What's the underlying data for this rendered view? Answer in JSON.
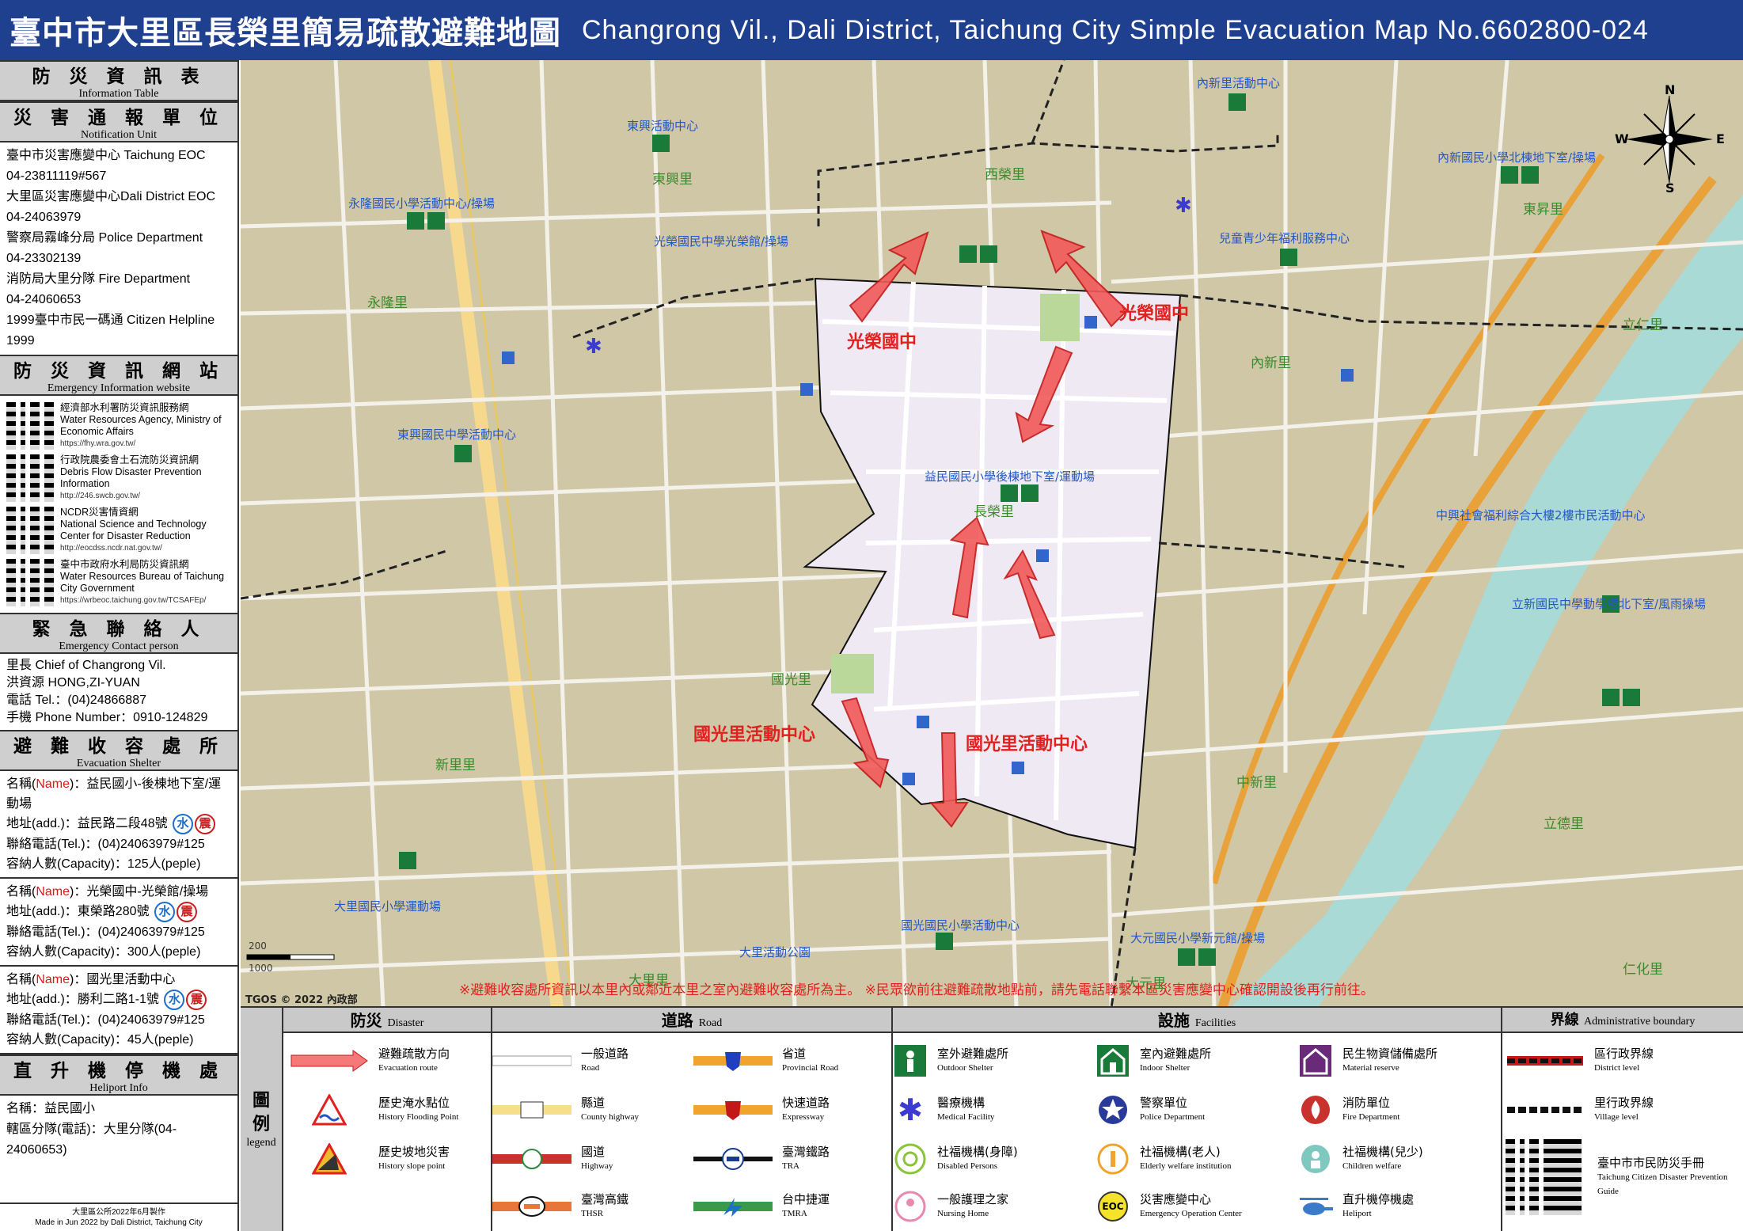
{
  "header": {
    "title_zh": "臺中市大里區長榮里簡易疏散避難地圖",
    "title_en": "Changrong Vil., Dali District, Taichung City Simple Evacuation Map No.6602800-024"
  },
  "side": {
    "info_table": {
      "zh": "防 災 資 訊 表",
      "en": "Information Table"
    },
    "notification": {
      "zh": "災 害 通 報 單 位",
      "en": "Notification Unit",
      "lines": [
        "臺中市災害應變中心 Taichung EOC",
        "04-23811119#567",
        "大里區災害應變中心Dali District EOC",
        "04-24063979",
        "警察局霧峰分局 Police Department",
        "04-23302139",
        "消防局大里分隊 Fire Department",
        "04-24060653",
        "1999臺中市民一碼通 Citizen Helpline",
        "1999"
      ]
    },
    "website": {
      "zh": "防 災 資 訊 網 站",
      "en": "Emergency Information website",
      "items": [
        {
          "zh": "經濟部水利署防災資訊服務網",
          "en": "Water Resources Agency, Ministry of Economic Affairs",
          "url": "https://fhy.wra.gov.tw/"
        },
        {
          "zh": "行政院農委會土石流防災資訊網",
          "en": "Debris Flow Disaster Prevention Information",
          "url": "http://246.swcb.gov.tw/"
        },
        {
          "zh": "NCDR災害情資網",
          "en": "National Science and Technology Center for Disaster Reduction",
          "url": "http://eocdss.ncdr.nat.gov.tw/"
        },
        {
          "zh": "臺中市政府水利局防災資訊網",
          "en": "Water Resources Bureau of Taichung City Government",
          "url": "https://wrbeoc.taichung.gov.tw/TCSAFEp/"
        }
      ]
    },
    "contact": {
      "zh": "緊 急 聯 絡 人",
      "en": "Emergency Contact person",
      "lines": [
        "里長 Chief of Changrong Vil.",
        "洪資源 HONG,ZI-YUAN",
        "電話 Tel.：(04)24866887",
        "手機 Phone Number：0910-124829"
      ]
    },
    "shelter": {
      "zh": "避 難 收 容 處 所",
      "en": "Evacuation Shelter",
      "items": [
        {
          "name_label": "名稱(",
          "name_mid": "Name",
          "name_end": ")：益民國小-後棟地下室/運動場",
          "addr": "地址(add.)：益民路二段48號",
          "tel": "聯絡電話(Tel.)：(04)24063979#125",
          "cap": "容納人數(Capacity)：125人(peple)"
        },
        {
          "name_label": "名稱(",
          "name_mid": "Name",
          "name_end": ")：光榮國中-光榮館/操場",
          "addr": "地址(add.)：東榮路280號",
          "tel": "聯絡電話(Tel.)：(04)24063979#125",
          "cap": "容納人數(Capacity)：300人(peple)"
        },
        {
          "name_label": "名稱(",
          "name_mid": "Name",
          "name_end": ")：國光里活動中心",
          "addr": "地址(add.)：勝利二路1-1號",
          "tel": "聯絡電話(Tel.)：(04)24063979#125",
          "cap": "容納人數(Capacity)：45人(peple)"
        }
      ],
      "badge_water": "水",
      "badge_quake": "震"
    },
    "heliport": {
      "zh": "直 升 機 停 機 處",
      "en": "Heliport Info",
      "lines": [
        "名稱：益民國小",
        "轄區分隊(電話)：大里分隊(04-24060653)"
      ]
    },
    "footer": [
      "大里區公所2022年6月製作",
      "Made in Jun 2022 by Dali District, Taichung City"
    ]
  },
  "map": {
    "compass": {
      "n": "N",
      "s": "S",
      "e": "E",
      "w": "W"
    },
    "copyright": "TGOS © 2022 內政部",
    "warning": "※避難收容處所資訊以本里內或鄰近本里之室內避難收容處所為主。 ※民眾欲前往避難疏散地點前，請先電話聯繫本區災害應變中心確認開設後再行前往。",
    "scale": [
      "200",
      "1000"
    ],
    "evac_labels": [
      "光榮國中",
      "光榮國中",
      "國光里活動中心",
      "國光里活動中心"
    ],
    "shelter_labels": [
      "光榮國民中學光榮館/操場",
      "益民國民小學後棟地下室/運動場",
      "永隆國民小學活動中心/操場",
      "東興活動中心",
      "內新里活動中心",
      "內新國民小學北棟地下室/操場",
      "兒童青少年福利服務中心",
      "東興國民中學活動中心",
      "中興社會福利綜合大樓2樓市民活動中心",
      "立新國民中學動學樓北下室/風雨操場",
      "大里國民小學運動場",
      "國光國民小學活動中心",
      "大元國民小學新元館/操場",
      "大里活動公園"
    ],
    "village_labels": [
      "東興里",
      "西榮里",
      "永隆里",
      "東昇里",
      "內新里",
      "長榮里",
      "國光里",
      "新里里",
      "中新里",
      "立德里",
      "大里里",
      "仁化里",
      "大元里",
      "立仁里"
    ]
  },
  "legend": {
    "side": {
      "zh1": "圖",
      "zh2": "例",
      "en": "legend"
    },
    "disaster": {
      "zh": "防災",
      "en": "Disaster",
      "items": [
        {
          "zh": "避難疏散方向",
          "en": "Evacuation route"
        },
        {
          "zh": "歷史淹水點位",
          "en": "History Flooding Point"
        },
        {
          "zh": "歷史坡地災害",
          "en": "History slope point"
        }
      ]
    },
    "road": {
      "zh": "道路",
      "en": "Road",
      "items": [
        {
          "zh": "一般道路",
          "en": "Road"
        },
        {
          "zh": "省道",
          "en": "Provincial Road"
        },
        {
          "zh": "縣道",
          "en": "County highway"
        },
        {
          "zh": "快速道路",
          "en": "Expressway"
        },
        {
          "zh": "國道",
          "en": "Highway"
        },
        {
          "zh": "臺灣鐵路",
          "en": "TRA"
        },
        {
          "zh": "臺灣高鐵",
          "en": "THSR"
        },
        {
          "zh": "台中捷運",
          "en": "TMRA"
        }
      ]
    },
    "facilities": {
      "zh": "設施",
      "en": "Facilities",
      "items": [
        {
          "zh": "室外避難處所",
          "en": "Outdoor Shelter"
        },
        {
          "zh": "室內避難處所",
          "en": "Indoor Shelter"
        },
        {
          "zh": "民生物資儲備處所",
          "en": "Material reserve"
        },
        {
          "zh": "醫療機構",
          "en": "Medical Facility"
        },
        {
          "zh": "警察單位",
          "en": "Police Department"
        },
        {
          "zh": "消防單位",
          "en": "Fire Department"
        },
        {
          "zh": "社福機構(身障)",
          "en": "Disabled Persons"
        },
        {
          "zh": "社福機構(老人)",
          "en": "Elderly welfare institution"
        },
        {
          "zh": "社福機構(兒少)",
          "en": "Children welfare"
        },
        {
          "zh": "一般護理之家",
          "en": "Nursing Home"
        },
        {
          "zh": "災害應變中心",
          "en": "Emergency Operation Center"
        },
        {
          "zh": "直升機停機處",
          "en": "Heliport"
        }
      ],
      "eoc_text": "EOC"
    },
    "boundary": {
      "zh": "界線",
      "en": "Administrative boundary",
      "items": [
        {
          "zh": "區行政界線",
          "en": "District level"
        },
        {
          "zh": "里行政界線",
          "en": "Village level"
        }
      ],
      "guide": {
        "zh": "臺中市市民防災手冊",
        "en": "Taichung Citizen Disaster Prevention Guide"
      }
    }
  }
}
